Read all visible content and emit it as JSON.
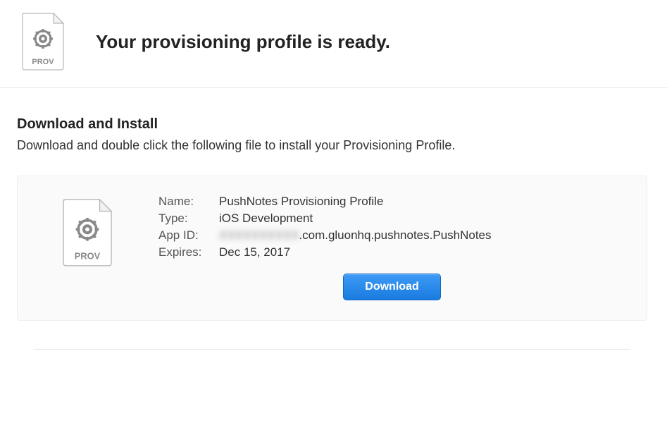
{
  "header": {
    "title": "Your provisioning profile is ready.",
    "icon_label": "PROV"
  },
  "section": {
    "title": "Download and Install",
    "description": "Download and double click the following file to install your Provisioning Profile."
  },
  "profile": {
    "icon_label": "PROV",
    "labels": {
      "name": "Name:",
      "type": "Type:",
      "app_id": "App ID:",
      "expires": "Expires:"
    },
    "name": "PushNotes Provisioning Profile",
    "type": "iOS Development",
    "app_id_prefix_hidden": "XXXXXXXXXX",
    "app_id_suffix": ".com.gluonhq.pushnotes.PushNotes",
    "expires": "Dec 15, 2017"
  },
  "actions": {
    "download_label": "Download"
  }
}
